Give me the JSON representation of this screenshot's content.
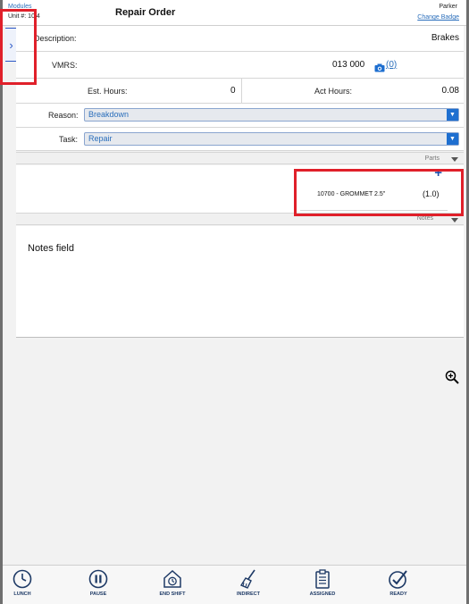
{
  "header": {
    "modules_link": "Modules",
    "unit_label": "Unit #: 10.4",
    "title": "Repair Order",
    "user_name": "Parker",
    "change_badge": "Change Badge"
  },
  "form": {
    "description_label": "Description:",
    "description_value": "Brakes",
    "vmrs_label": "VMRS:",
    "vmrs_value": "013 000",
    "vmrs_photo_count": "(0)",
    "est_hours_label": "Est. Hours:",
    "est_hours_value": "0",
    "act_hours_label": "Act Hours:",
    "act_hours_value": "0.08",
    "reason_label": "Reason:",
    "reason_value": "Breakdown",
    "task_label": "Task:",
    "task_value": "Repair"
  },
  "parts": {
    "section_label": "Parts",
    "add_label": "+",
    "items": [
      {
        "description": "10700 - GROMMET 2.5\"",
        "quantity": "(1.0)"
      }
    ]
  },
  "notes": {
    "section_label": "Notes",
    "placeholder": "Notes field"
  },
  "tabbar": {
    "items": [
      {
        "label": "LUNCH",
        "icon": "clock-icon"
      },
      {
        "label": "PAUSE",
        "icon": "pause-icon"
      },
      {
        "label": "END SHIFT",
        "icon": "house-clock-icon"
      },
      {
        "label": "INDIRECT",
        "icon": "broom-icon"
      },
      {
        "label": "ASSIGNED",
        "icon": "clipboard-icon"
      },
      {
        "label": "READY",
        "icon": "check-icon"
      }
    ]
  },
  "colors": {
    "accent": "#2a6ebb",
    "highlight": "#e0202a",
    "tab_icon": "#1e3a66"
  }
}
